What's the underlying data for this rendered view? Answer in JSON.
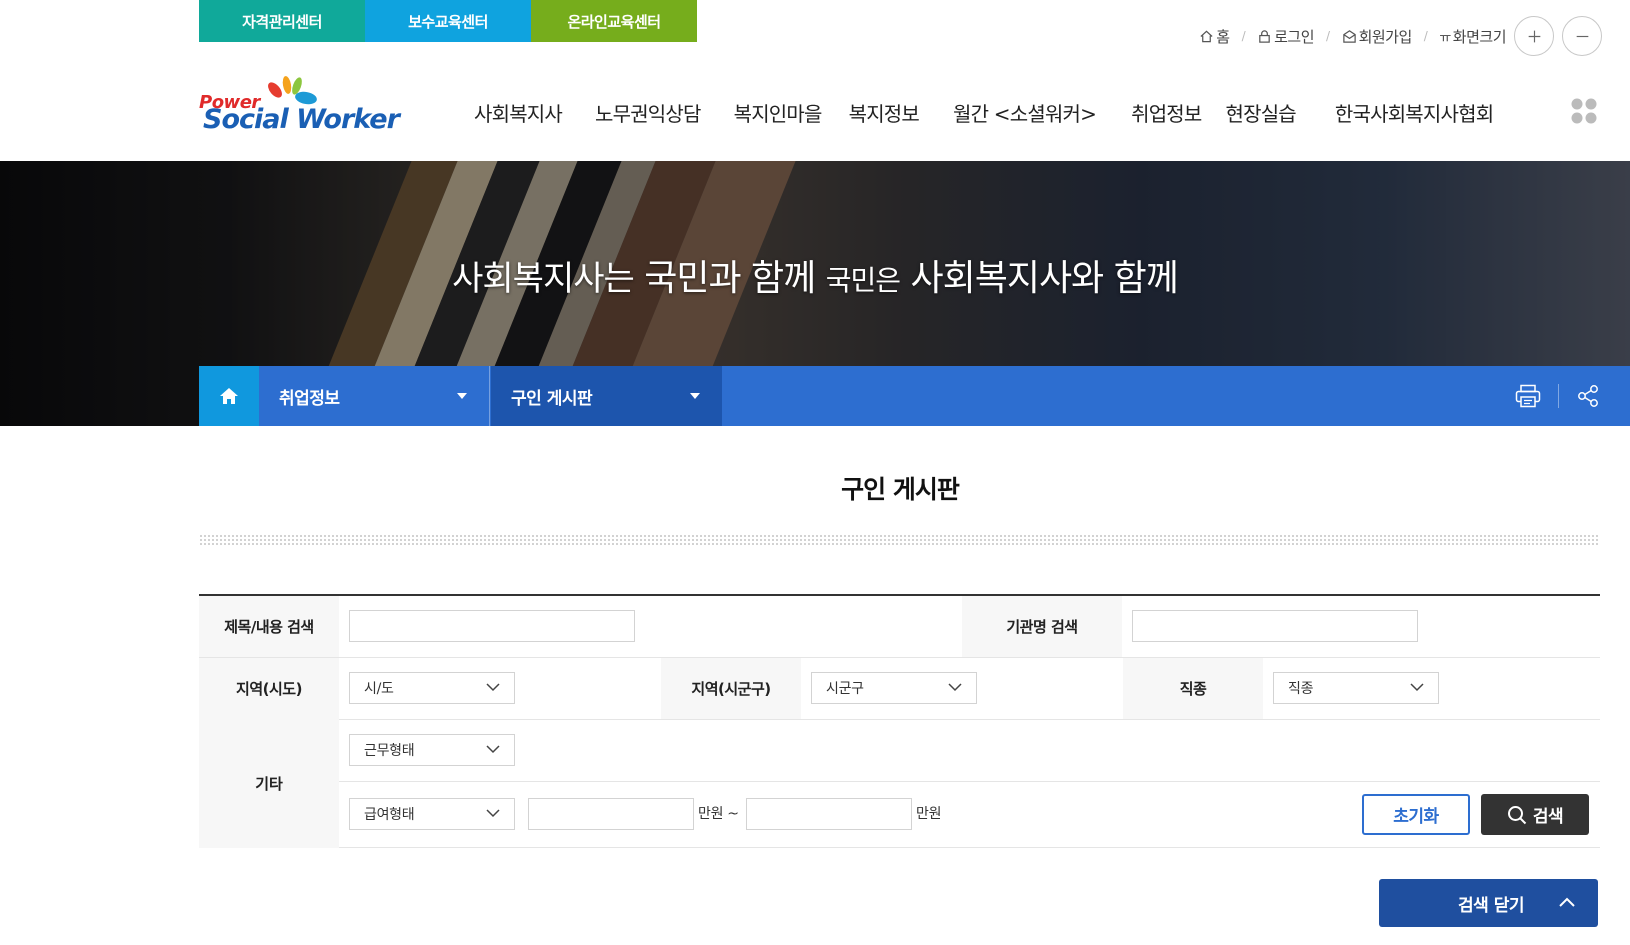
{
  "top_tabs": [
    "자격관리센터",
    "보수교육센터",
    "온라인교육센터"
  ],
  "util": {
    "home": "홈",
    "login": "로그인",
    "join": "회원가입",
    "font_size": "화면크기",
    "tt_glyph": "ㅠ"
  },
  "logo": {
    "power": "Power",
    "name": "Social Worker"
  },
  "main_nav": [
    "사회복지사",
    "노무권익상담",
    "복지인마을",
    "복지정보",
    "월간 <소셜워커>",
    "취업정보",
    "현장실습",
    "한국사회복지사협회"
  ],
  "hero": {
    "caption_a": "사회복지사는",
    "caption_b": " 국민과 함께 ",
    "caption_c": "국민은",
    "caption_d": " 사회복지사와 함께"
  },
  "location": {
    "level1": "취업정보",
    "level2": "구인 게시판"
  },
  "page_title": "구인 게시판",
  "search": {
    "title_label": "제목/내용 검색",
    "title_value": "",
    "org_label": "기관명 검색",
    "org_value": "",
    "sido_label": "지역(시도)",
    "sido_value": "시/도",
    "sigungu_label": "지역(시군구)",
    "sigungu_value": "시군구",
    "job_label": "직종",
    "job_value": "직종",
    "etc_label": "기타",
    "work_type_value": "근무형태",
    "pay_type_value": "급여형태",
    "pay_min_value": "",
    "pay_max_value": "",
    "unit_from": "만원 ~",
    "unit_to": "만원",
    "reset_label": "초기화",
    "search_label": "검색",
    "close_label": "검색 닫기"
  },
  "colors": {
    "tab1": "#10a99a",
    "tab2": "#0fa3df",
    "tab3": "#76ad1c",
    "loc_bar": "#2d6ed0",
    "loc_home": "#1098de",
    "close_btn": "#1f4f9f"
  }
}
